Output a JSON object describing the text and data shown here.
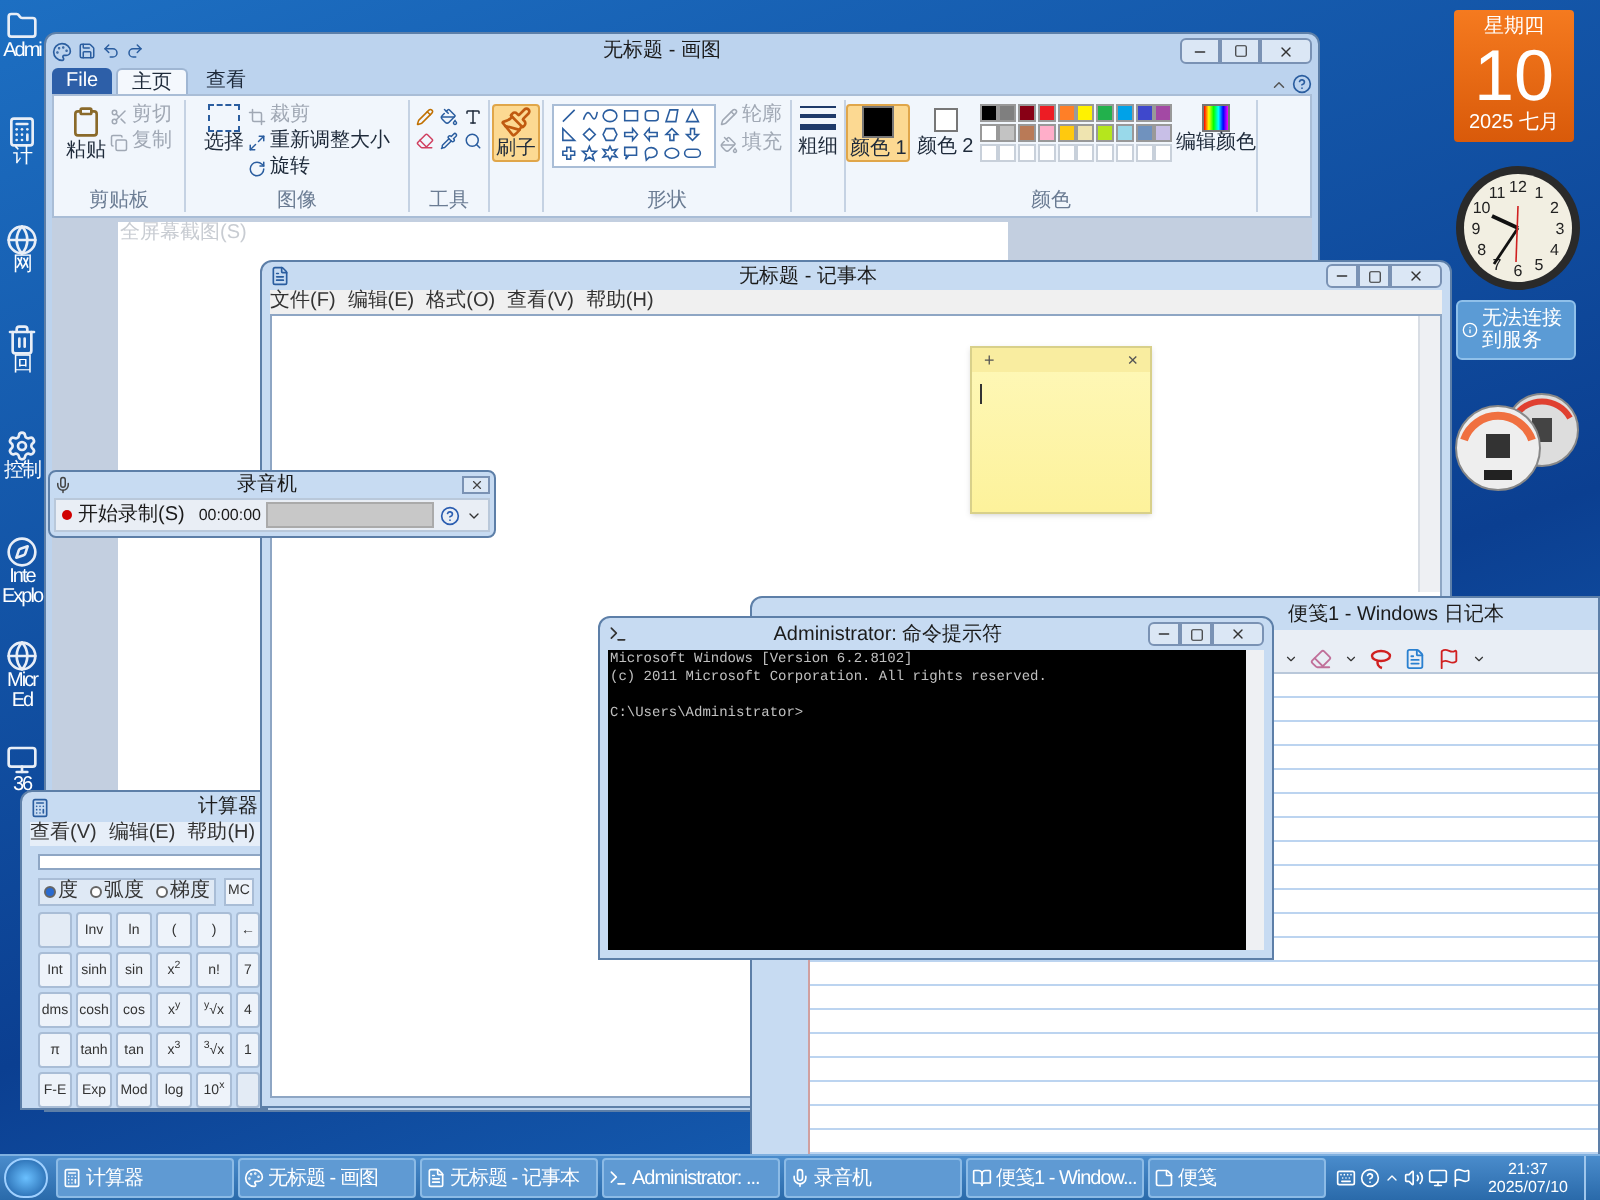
{
  "desktop_icons": [
    {
      "lines": [
        "Admi"
      ]
    },
    {
      "lines": [
        "计"
      ]
    },
    {
      "lines": [
        "网"
      ]
    },
    {
      "lines": [
        "回"
      ]
    },
    {
      "lines": [
        "控制"
      ]
    },
    {
      "lines": [
        "Inte",
        "Explo"
      ]
    },
    {
      "lines": [
        "Micr",
        "Ed"
      ]
    },
    {
      "lines": [
        "36"
      ]
    }
  ],
  "paint": {
    "title": "无标题 - 画图",
    "tabs": [
      {
        "label": "File",
        "kind": "file",
        "selected": false
      },
      {
        "label": "主页",
        "kind": "tab",
        "selected": true
      },
      {
        "label": "查看",
        "kind": "tab",
        "selected": false
      }
    ],
    "clipboard": {
      "label": "剪贴板",
      "paste": "粘贴",
      "small": [
        {
          "label": "剪切",
          "disabled": true
        },
        {
          "label": "复制",
          "disabled": true
        }
      ]
    },
    "image": {
      "label": "图像",
      "select": "选择",
      "small": [
        {
          "label": "裁剪",
          "disabled": true
        },
        {
          "label": "重新调整大小",
          "disabled": false
        },
        {
          "label": "旋转",
          "disabled": false
        }
      ]
    },
    "tools": {
      "label": "工具"
    },
    "brush": {
      "label": "刷子",
      "selected": true
    },
    "shapes": {
      "label": "形状",
      "small": [
        {
          "label": "轮廓",
          "disabled": true
        },
        {
          "label": "填充",
          "disabled": true
        }
      ]
    },
    "size": {
      "label": "粗细"
    },
    "colors": {
      "label": "颜色",
      "edit": "编辑颜色",
      "slots": [
        {
          "label": "颜色 1",
          "color": "#000000",
          "selected": true
        },
        {
          "label": "颜色 2",
          "color": "#ffffff",
          "selected": false
        }
      ],
      "palette": [
        {
          "color": "#000000"
        },
        {
          "color": "#7f7f7f"
        },
        {
          "color": "#880015"
        },
        {
          "color": "#ed1c24"
        },
        {
          "color": "#ff7f27"
        },
        {
          "color": "#fff200"
        },
        {
          "color": "#22b14c"
        },
        {
          "color": "#00a2e8"
        },
        {
          "color": "#3f48cc"
        },
        {
          "color": "#a349a4"
        },
        {
          "color": "#ffffff"
        },
        {
          "color": "#c3c3c3"
        },
        {
          "color": "#b97a57"
        },
        {
          "color": "#ffaec9"
        },
        {
          "color": "#ffc90e"
        },
        {
          "color": "#efe4b0"
        },
        {
          "color": "#b5e61d"
        },
        {
          "color": "#99d9ea"
        },
        {
          "color": "#7092be"
        },
        {
          "color": "#c8bfe7"
        }
      ]
    },
    "tooltip": "全屏幕截图(S)"
  },
  "notepad": {
    "title": "无标题 - 记事本",
    "menu": [
      "文件(F)",
      "编辑(E)",
      "格式(O)",
      "查看(V)",
      "帮助(H)"
    ]
  },
  "sticky_note": {
    "add": "+",
    "close": "×"
  },
  "recorder": {
    "title": "录音机",
    "record": "开始录制(S)",
    "time": "00:00:00"
  },
  "calculator": {
    "title": "计算器",
    "menu": [
      "查看(V)",
      "编辑(E)",
      "帮助(H)"
    ],
    "angle_modes": [
      {
        "label": "度",
        "selected": true
      },
      {
        "label": "弧度",
        "selected": false
      },
      {
        "label": "梯度",
        "selected": false
      }
    ],
    "memory": "MC",
    "keys": [
      [
        {
          "kind": "blank"
        },
        {
          "kind": "key",
          "label": "Inv"
        },
        {
          "kind": "key",
          "label": "ln"
        },
        {
          "kind": "key",
          "label": "("
        },
        {
          "kind": "key",
          "label": ")"
        },
        {
          "kind": "key",
          "label": "←"
        }
      ],
      [
        {
          "kind": "key",
          "label": "Int"
        },
        {
          "kind": "key",
          "label": "sinh"
        },
        {
          "kind": "key",
          "label": "sin"
        },
        {
          "kind": "key",
          "label": "x$^{2}$"
        },
        {
          "kind": "key",
          "label": "n!"
        },
        {
          "kind": "key",
          "label": "7"
        }
      ],
      [
        {
          "kind": "key",
          "label": "dms"
        },
        {
          "kind": "key",
          "label": "cosh"
        },
        {
          "kind": "key",
          "label": "cos"
        },
        {
          "kind": "key",
          "label": "x$^{y}$"
        },
        {
          "kind": "key",
          "label": "$^{y}$√x"
        },
        {
          "kind": "key",
          "label": "4"
        }
      ],
      [
        {
          "kind": "key",
          "label": "π"
        },
        {
          "kind": "key",
          "label": "tanh"
        },
        {
          "kind": "key",
          "label": "tan"
        },
        {
          "kind": "key",
          "label": "x$^{3}$"
        },
        {
          "kind": "key",
          "label": "$^{3}$√x"
        },
        {
          "kind": "key",
          "label": "1"
        }
      ],
      [
        {
          "kind": "key",
          "label": "F-E"
        },
        {
          "kind": "key",
          "label": "Exp"
        },
        {
          "kind": "key",
          "label": "Mod"
        },
        {
          "kind": "key",
          "label": "log"
        },
        {
          "kind": "key",
          "label": "10$^{x}$"
        },
        {
          "kind": "blank"
        }
      ]
    ]
  },
  "journal": {
    "title": "便笺1 - Windows 日记本"
  },
  "console": {
    "title": "Administrator: 命令提示符",
    "output": [
      "Microsoft Windows [Version 6.2.8102]",
      "(c) 2011 Microsoft Corporation. All rights reserved."
    ],
    "prompt": "C:\\Users\\Administrator>"
  },
  "gadgets": {
    "calendar": {
      "weekday": "星期四",
      "day": "10",
      "month": "2025 七月"
    },
    "clock": {
      "numerals": [
        "12",
        "11",
        "1",
        "10",
        "2",
        "9",
        "3",
        "8",
        "4",
        "7",
        "5",
        "6"
      ]
    },
    "weather": {
      "message": "无法连接到服务"
    }
  },
  "taskbar": {
    "items": [
      {
        "label": "计算器",
        "kind": "calculator"
      },
      {
        "label": "无标题 - 画图",
        "kind": "paint"
      },
      {
        "label": "无标题 - 记事本",
        "kind": "notepad"
      },
      {
        "label": "Administrator: ...",
        "kind": "console"
      },
      {
        "label": "录音机",
        "kind": "recorder"
      },
      {
        "label": "便笺1 - Window...",
        "kind": "journal"
      },
      {
        "label": "便笺",
        "kind": "sticky"
      }
    ],
    "time": "21:37",
    "date": "2025/07/10"
  }
}
